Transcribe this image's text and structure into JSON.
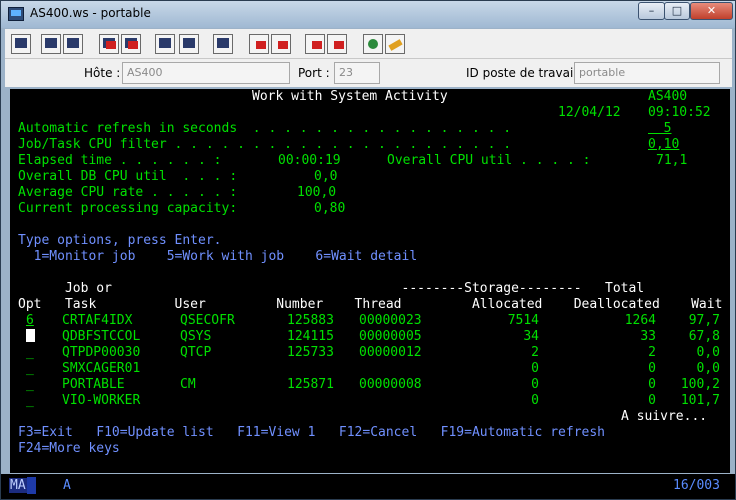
{
  "window": {
    "title": "AS400.ws - portable",
    "min_label": "–",
    "max_label": "□",
    "close_label": "✕"
  },
  "toolbar": {
    "icons": [
      "print-screen-icon",
      "copy-icon",
      "paste-icon",
      "send-icon",
      "receive-icon",
      "display-icon",
      "keyboard-map-icon",
      "keyboard-icon",
      "macro-record-icon",
      "macro-play-icon",
      "macro-stop-icon",
      "macro-play2-icon",
      "globe-icon",
      "edit-icon"
    ]
  },
  "hostbar": {
    "host_label": "Hôte :",
    "host_value": "AS400",
    "port_label": "Port :",
    "port_value": "23",
    "ws_label": "ID poste de travail :",
    "ws_value": "portable"
  },
  "screen": {
    "title": "Work with System Activity",
    "system": "AS400",
    "date": "12/04/12",
    "time": "09:10:52",
    "refresh_label": "Automatic refresh in seconds  . . . . . . . . . . . . . . . . .",
    "refresh_value": "  5",
    "cpu_filter_label": "Job/Task CPU filter . . . . . . . . . . . . . . . . . . . . . .",
    "cpu_filter_value": "0,10",
    "elapsed_label": "Elapsed time . . . . . . :",
    "elapsed_value": "00:00:19",
    "overall_cpu_label": "Overall CPU util . . . . :",
    "overall_cpu_value": "71,1",
    "db_cpu_label": "Overall DB CPU util  . . . :",
    "db_cpu_value": "0,0",
    "avg_cpu_label": "Average CPU rate . . . . . :",
    "avg_cpu_value": "100,0",
    "capacity_label": "Current processing capacity:",
    "capacity_value": "0,80",
    "instructions": "Type options, press Enter.",
    "options": "  1=Monitor job    5=Work with job    6=Wait detail",
    "header1": "      Job or                                     --------Storage--------   Total",
    "header2": "Opt   Task          User         Number    Thread         Allocated    Deallocated    Wait",
    "rows": [
      {
        "opt": "6",
        "task": "CRTAF4IDX",
        "user": "QSECOFR",
        "number": "125883",
        "thread": "00000023",
        "alloc": "7514",
        "dealloc": "1264",
        "wait": "97,7"
      },
      {
        "opt": "",
        "task": "QDBFSTCCOL",
        "user": "QSYS",
        "number": "124115",
        "thread": "00000005",
        "alloc": "34",
        "dealloc": "33",
        "wait": "67,8"
      },
      {
        "opt": "_",
        "task": "QTPDP00030",
        "user": "QTCP",
        "number": "125733",
        "thread": "00000012",
        "alloc": "2",
        "dealloc": "2",
        "wait": "0,0"
      },
      {
        "opt": "_",
        "task": "SMXCAGER01",
        "user": "",
        "number": "",
        "thread": "",
        "alloc": "0",
        "dealloc": "0",
        "wait": "0,0"
      },
      {
        "opt": "_",
        "task": "PORTABLE",
        "user": "CM",
        "number": "125871",
        "thread": "00000008",
        "alloc": "0",
        "dealloc": "0",
        "wait": "100,2"
      },
      {
        "opt": "_",
        "task": "VIO-WORKER",
        "user": "",
        "number": "",
        "thread": "",
        "alloc": "0",
        "dealloc": "0",
        "wait": "101,7"
      }
    ],
    "more": "A suivre...",
    "fkeys1": "F3=Exit   F10=Update list   F11=View 1   F12=Cancel   F19=Automatic refresh",
    "fkeys2": "F24=More keys"
  },
  "status": {
    "ma": "MA",
    "mode": "A",
    "position": "16/003"
  }
}
